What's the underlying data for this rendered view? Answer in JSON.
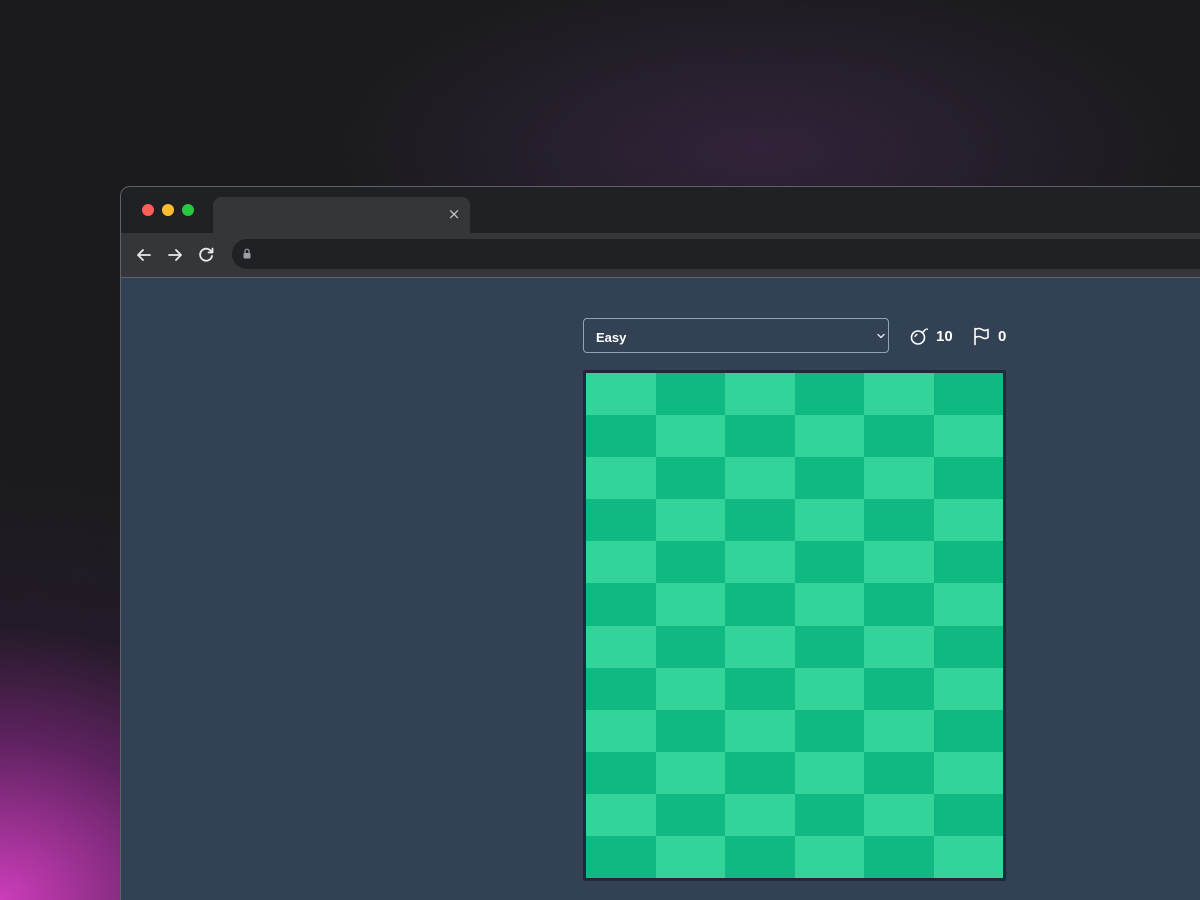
{
  "browser": {
    "tab": {
      "title": "",
      "close_glyph": "×"
    },
    "address_bar": {
      "url": ""
    },
    "icons": {
      "back": "arrow-left-icon",
      "forward": "arrow-right-icon",
      "reload": "reload-icon",
      "lock": "lock-icon"
    }
  },
  "game": {
    "difficulty": {
      "selected": "Easy"
    },
    "mines": {
      "icon": "bomb-icon",
      "count": "10"
    },
    "flags": {
      "icon": "flag-icon",
      "count": "0"
    },
    "board": {
      "rows": 12,
      "cols": 6,
      "cell_state": "unrevealed",
      "colors": {
        "light": "#34d399",
        "dark": "#10b981",
        "border": "#1e293b"
      }
    }
  },
  "colors": {
    "page_background": "#334155",
    "chrome_dark": "#202124",
    "chrome_toolbar": "#35363a"
  }
}
